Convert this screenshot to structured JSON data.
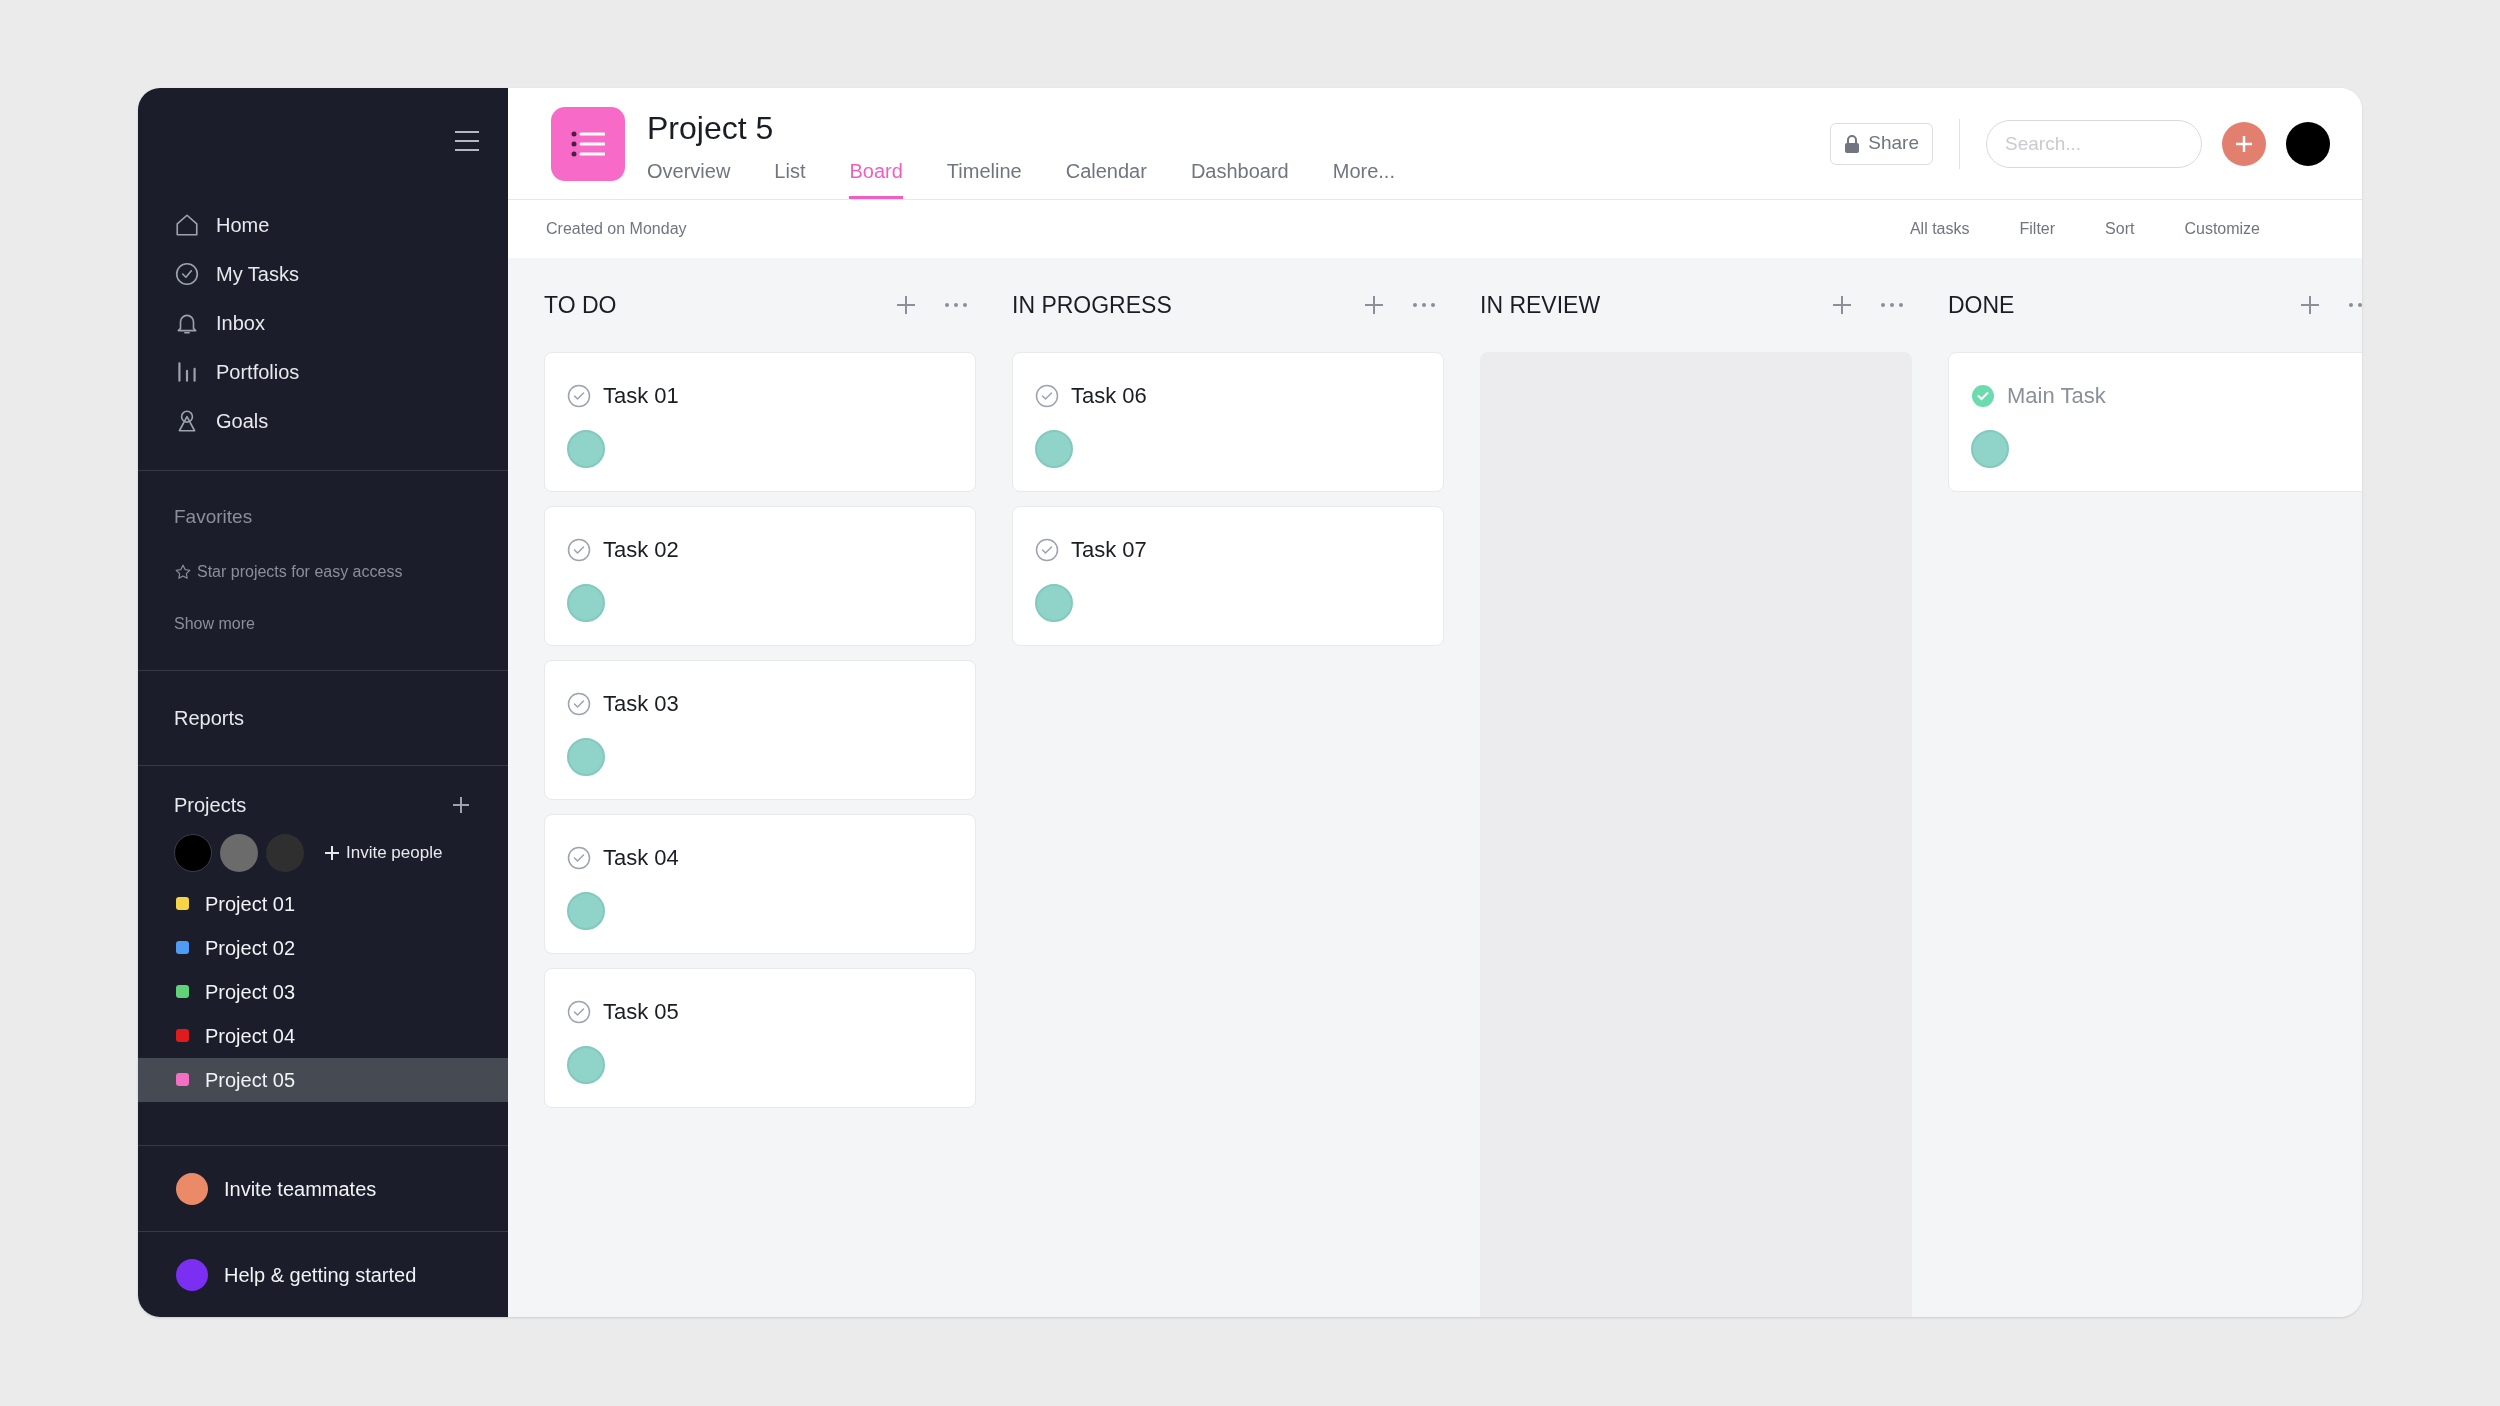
{
  "sidebar": {
    "nav": [
      {
        "label": "Home"
      },
      {
        "label": "My Tasks"
      },
      {
        "label": "Inbox"
      },
      {
        "label": "Portfolios"
      },
      {
        "label": "Goals"
      }
    ],
    "favorites": {
      "title": "Favorites",
      "hint": "Star projects for easy access",
      "more": "Show more"
    },
    "reports": "Reports",
    "projects": {
      "title": "Projects",
      "invite": "Invite people",
      "items": [
        {
          "label": "Project 01",
          "color": "#f5d547",
          "selected": false
        },
        {
          "label": "Project 02",
          "color": "#4f9cf5",
          "selected": false
        },
        {
          "label": "Project 03",
          "color": "#5fd37a",
          "selected": false
        },
        {
          "label": "Project 04",
          "color": "#e01b1b",
          "selected": false
        },
        {
          "label": "Project 05",
          "color": "#f36fc4",
          "selected": true
        }
      ]
    },
    "footer": [
      "Invite teammates",
      "Help & getting started"
    ]
  },
  "header": {
    "title": "Project 5",
    "tabs": [
      {
        "label": "Overview",
        "selected": false
      },
      {
        "label": "List",
        "selected": false
      },
      {
        "label": "Board",
        "selected": true
      },
      {
        "label": "Timeline",
        "selected": false
      },
      {
        "label": "Calendar",
        "selected": false
      },
      {
        "label": "Dashboard",
        "selected": false
      },
      {
        "label": "More...",
        "selected": false
      }
    ],
    "share": "Share",
    "search": {
      "placeholder": "Search..."
    }
  },
  "toolbar": {
    "created": "Created on Monday",
    "actions": [
      "All tasks",
      "Filter",
      "Sort",
      "Customize"
    ]
  },
  "columns": [
    {
      "title": "TO DO",
      "tasks": [
        {
          "title": "Task 01",
          "completed": false
        },
        {
          "title": "Task 02",
          "completed": false
        },
        {
          "title": "Task 03",
          "completed": false
        },
        {
          "title": "Task 04",
          "completed": false
        },
        {
          "title": "Task 05",
          "completed": false
        }
      ]
    },
    {
      "title": "IN PROGRESS",
      "tasks": [
        {
          "title": "Task 06",
          "completed": false
        },
        {
          "title": "Task 07",
          "completed": false
        }
      ]
    },
    {
      "title": "IN REVIEW"
    },
    {
      "title": "DONE",
      "tasks": [
        {
          "title": "Main Task",
          "completed": true
        }
      ]
    }
  ]
}
